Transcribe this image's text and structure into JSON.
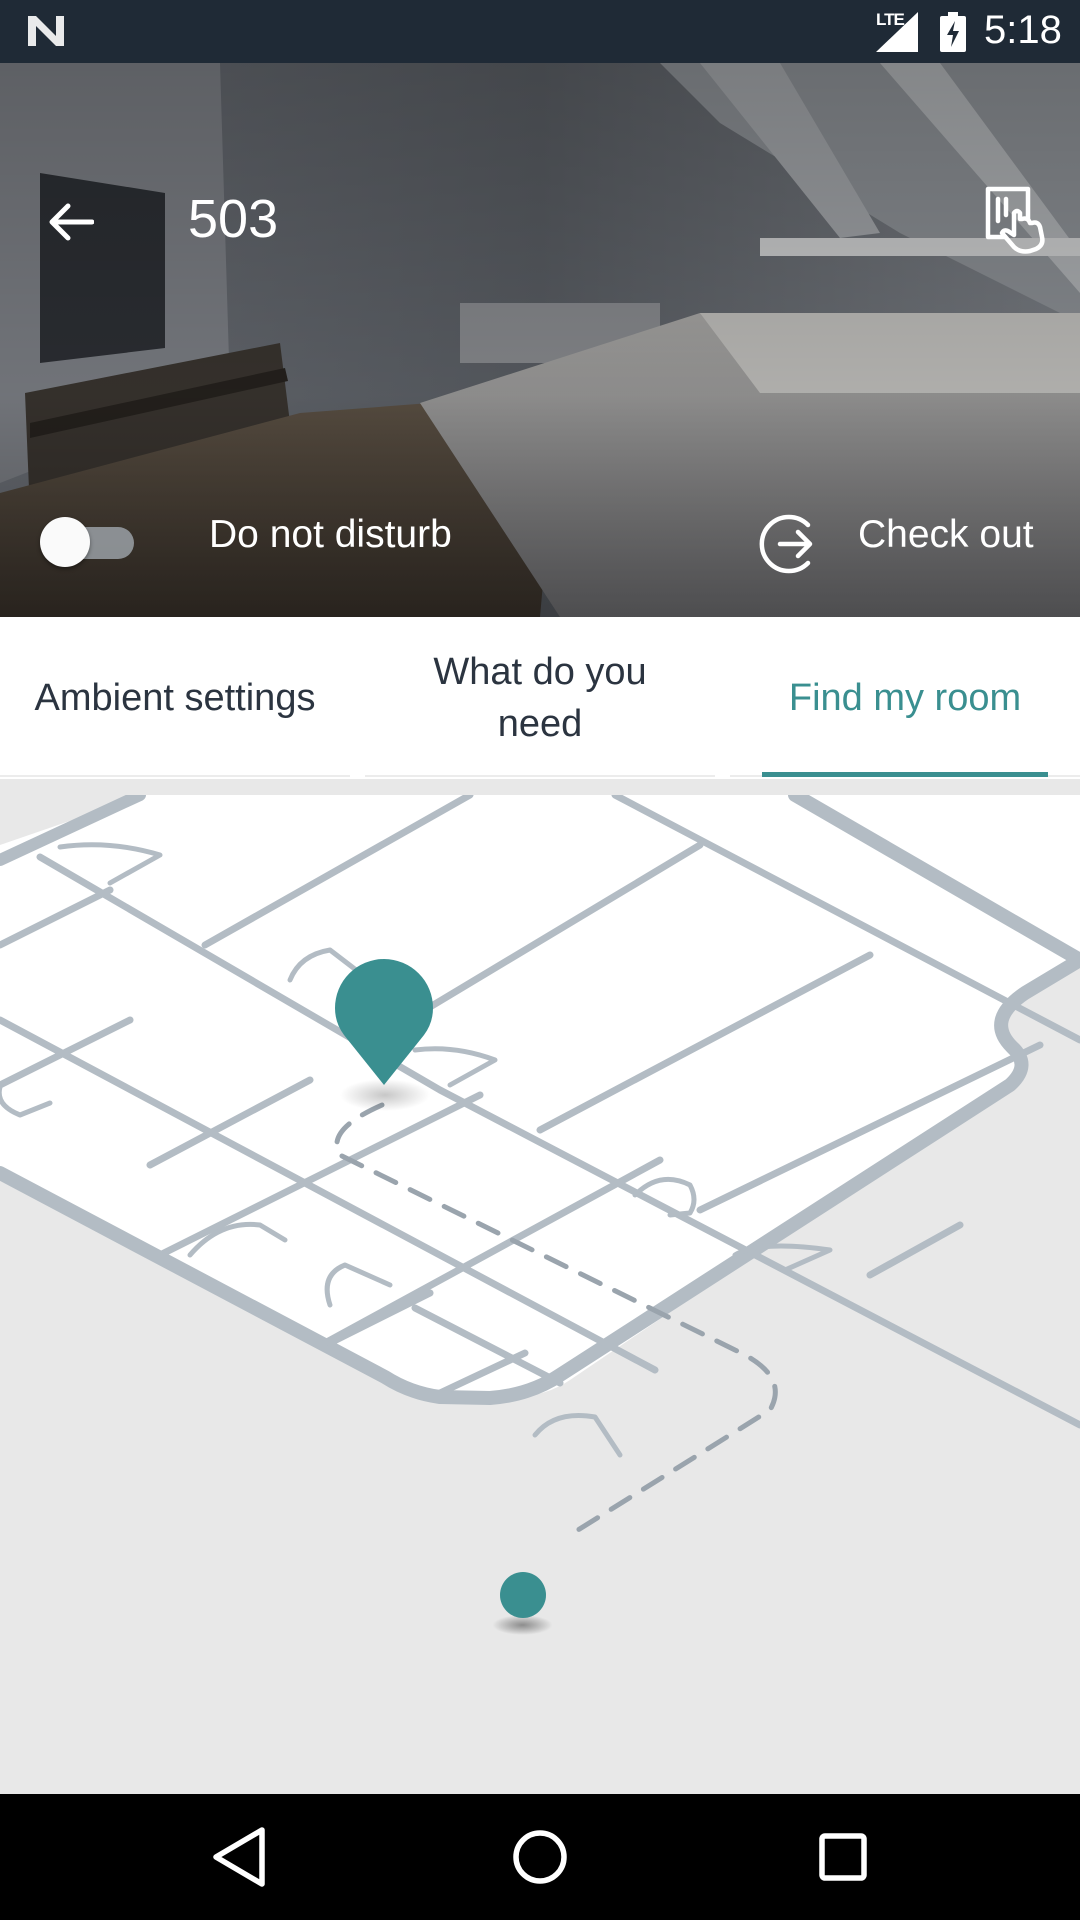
{
  "status_bar": {
    "network_label": "LTE",
    "time": "5:18"
  },
  "header": {
    "room_number": "503",
    "dnd_label": "Do not disturb",
    "dnd_on": false,
    "checkout_label": "Check out"
  },
  "tabs": [
    {
      "label": "Ambient settings",
      "active": false
    },
    {
      "label": "What do you need",
      "active": false
    },
    {
      "label": "Find my room",
      "active": true
    }
  ],
  "colors": {
    "accent": "#3a8f90",
    "status_bar": "#1f2a36",
    "map_wall": "#b3bcc4",
    "map_background": "#e8e8e8"
  },
  "icons": {
    "back": "arrow-left-icon",
    "key": "key-card-icon",
    "checkout": "exit-arrow-icon",
    "destination": "map-pin-icon",
    "current_location": "location-dot-icon"
  }
}
